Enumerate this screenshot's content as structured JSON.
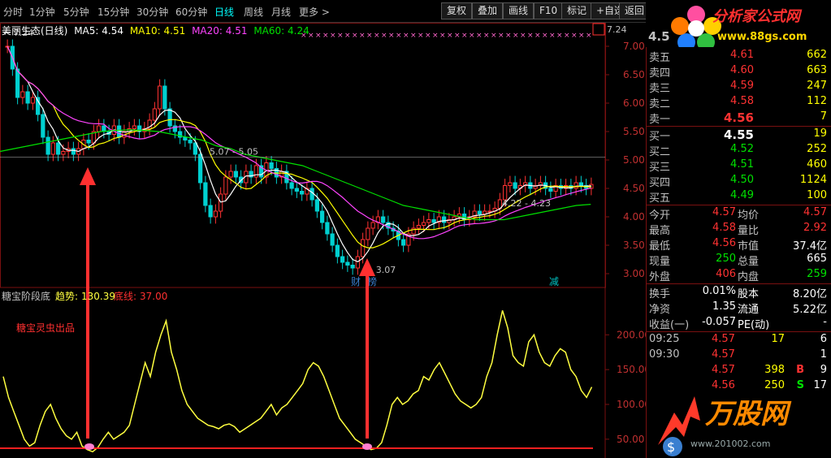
{
  "toolbar": {
    "timeframes": [
      "分时",
      "1分钟",
      "5分钟",
      "15分钟",
      "30分钟",
      "60分钟",
      "日线",
      "周线",
      "月线",
      "更多 >"
    ],
    "active_timeframe": "日线",
    "buttons": [
      "复权",
      "叠加",
      "画线",
      "F10",
      "标记",
      "+自选",
      "返回"
    ]
  },
  "logo": {
    "title": "分析家公式网",
    "url": "www.88gs.com"
  },
  "main_chart": {
    "title": "美丽生态(日线)",
    "ma": [
      {
        "label": "MA5: 4.54",
        "color": "#ffffff"
      },
      {
        "label": "MA10: 4.51",
        "color": "#ffff00"
      },
      {
        "label": "MA20: 4.51",
        "color": "#ff44ff"
      },
      {
        "label": "MA60: 4.24",
        "color": "#00e000"
      }
    ],
    "price_ticks": [
      "7.00",
      "6.50",
      "6.00",
      "5.50",
      "5.00",
      "4.50",
      "4.00",
      "3.50",
      "3.00"
    ],
    "high_label": "7.24",
    "right_high_label": "7.24",
    "annotation_1": "5.07 - 5.05",
    "annotation_2": "4.22 - 4.23",
    "low_label": "3.07",
    "marker_1": "财",
    "marker_2": "榜",
    "marker_3": "减"
  },
  "indicator": {
    "name": "糖宝阶段底",
    "trend_label": "趋势:",
    "trend_value": "130.39",
    "bottom_label": "底线:",
    "bottom_value": "37.00",
    "watermark": "糖宝灵虫出品",
    "ticks": [
      "200.00",
      "150.00",
      "100.00",
      "50.00"
    ]
  },
  "quote": {
    "price": "4.5",
    "asks": [
      {
        "label": "卖五",
        "price": "4.61",
        "vol": "662"
      },
      {
        "label": "卖四",
        "price": "4.60",
        "vol": "663"
      },
      {
        "label": "卖三",
        "price": "4.59",
        "vol": "247"
      },
      {
        "label": "卖二",
        "price": "4.58",
        "vol": "112"
      },
      {
        "label": "卖一",
        "price": "4.56",
        "vol": "7"
      }
    ],
    "bids": [
      {
        "label": "买一",
        "price": "4.55",
        "vol": "19"
      },
      {
        "label": "买二",
        "price": "4.52",
        "vol": "252"
      },
      {
        "label": "买三",
        "price": "4.51",
        "vol": "460"
      },
      {
        "label": "买四",
        "price": "4.50",
        "vol": "1124"
      },
      {
        "label": "买五",
        "price": "4.49",
        "vol": "100"
      }
    ],
    "stats": [
      {
        "l1": "今开",
        "v1": "4.57",
        "l2": "均价",
        "v2": "4.57"
      },
      {
        "l1": "最高",
        "v1": "4.58",
        "l2": "量比",
        "v2": "2.92"
      },
      {
        "l1": "最低",
        "v1": "4.56",
        "l2": "市值",
        "v2": "37.4亿"
      },
      {
        "l1": "现量",
        "v1": "250",
        "l2": "总量",
        "v2": "665"
      },
      {
        "l1": "外盘",
        "v1": "406",
        "l2": "内盘",
        "v2": "259"
      }
    ],
    "fund": [
      {
        "l1": "换手",
        "v1": "0.01%",
        "l2": "股本",
        "v2": "8.20亿"
      },
      {
        "l1": "净资",
        "v1": "1.35",
        "l2": "流通",
        "v2": "5.22亿"
      },
      {
        "l1": "收益(一)",
        "v1": "-0.057",
        "l2": "PE(动)",
        "v2": "-"
      }
    ],
    "ticks": [
      {
        "time": "09:25",
        "price": "4.57",
        "vol": "17",
        "flag": "",
        "n": "6"
      },
      {
        "time": "09:30",
        "price": "4.57",
        "vol": "",
        "flag": "",
        "n": "1"
      },
      {
        "time": "",
        "price": "4.57",
        "vol": "398",
        "flag": "B",
        "n": "9"
      },
      {
        "time": "",
        "price": "4.56",
        "vol": "250",
        "flag": "S",
        "n": "17"
      }
    ]
  },
  "watermark": {
    "text": "万股网",
    "url": "www.201002.com"
  },
  "chart_data": {
    "type": "line",
    "ylim_price": [
      2.9,
      7.3
    ],
    "ylim_indicator": [
      30,
      240
    ],
    "candles_close": [
      7.0,
      6.6,
      6.1,
      6.2,
      6.0,
      6.1,
      5.8,
      5.4,
      5.1,
      5.3,
      5.1,
      5.15,
      5.2,
      5.1,
      5.2,
      5.35,
      5.3,
      5.5,
      5.6,
      5.5,
      5.45,
      5.6,
      5.4,
      5.5,
      5.55,
      5.6,
      5.5,
      5.55,
      5.7,
      5.9,
      6.3,
      5.9,
      5.6,
      5.5,
      5.4,
      5.35,
      5.3,
      5.1,
      4.6,
      4.2,
      4.0,
      4.1,
      4.4,
      4.7,
      4.8,
      4.7,
      4.6,
      4.8,
      4.7,
      4.9,
      4.7,
      4.95,
      4.85,
      4.7,
      4.8,
      4.6,
      4.5,
      4.45,
      4.4,
      4.5,
      4.3,
      4.1,
      3.9,
      3.7,
      3.5,
      3.3,
      3.2,
      3.15,
      3.1,
      3.3,
      3.6,
      3.8,
      3.9,
      4.0,
      3.9,
      3.8,
      3.75,
      3.6,
      3.5,
      3.7,
      3.8,
      3.85,
      3.9,
      3.95,
      3.9,
      4.0,
      3.9,
      3.95,
      4.0,
      4.05,
      3.95,
      4.0,
      4.1,
      4.05,
      4.1,
      4.1,
      4.15,
      4.3,
      4.55,
      4.6,
      4.5,
      4.55,
      4.6,
      4.5,
      4.55,
      4.6,
      4.5,
      4.45,
      4.55,
      4.5,
      4.55,
      4.5,
      4.6,
      4.55,
      4.5,
      4.57
    ],
    "ma60": [
      5.15,
      5.2,
      5.25,
      5.3,
      5.35,
      5.4,
      5.45,
      5.5,
      5.52,
      5.53,
      5.52,
      5.5,
      5.45,
      5.4,
      5.35,
      5.25,
      5.2,
      5.1,
      5.05,
      5.0,
      4.95,
      4.9,
      4.8,
      4.7,
      4.6,
      4.5,
      4.4,
      4.3,
      4.2,
      4.15,
      4.1,
      4.05,
      4.0,
      3.95,
      3.95,
      3.95,
      4.0,
      4.05,
      4.1,
      4.15,
      4.2,
      4.22
    ],
    "indicator": [
      140,
      110,
      90,
      70,
      50,
      40,
      45,
      70,
      90,
      100,
      80,
      65,
      55,
      50,
      60,
      40,
      35,
      32,
      38,
      50,
      60,
      50,
      55,
      60,
      70,
      100,
      130,
      160,
      140,
      175,
      200,
      220,
      175,
      150,
      120,
      100,
      90,
      80,
      75,
      70,
      68,
      65,
      70,
      72,
      68,
      60,
      65,
      70,
      75,
      80,
      90,
      100,
      85,
      95,
      100,
      110,
      120,
      130,
      150,
      160,
      155,
      140,
      120,
      100,
      80,
      70,
      60,
      50,
      45,
      40,
      35,
      37,
      45,
      70,
      100,
      110,
      100,
      105,
      115,
      120,
      140,
      135,
      150,
      160,
      145,
      130,
      115,
      105,
      100,
      95,
      100,
      110,
      140,
      160,
      200,
      235,
      210,
      170,
      160,
      155,
      190,
      200,
      175,
      160,
      155,
      170,
      180,
      175,
      150,
      140,
      120,
      110,
      125
    ],
    "bottom_line": 37
  }
}
